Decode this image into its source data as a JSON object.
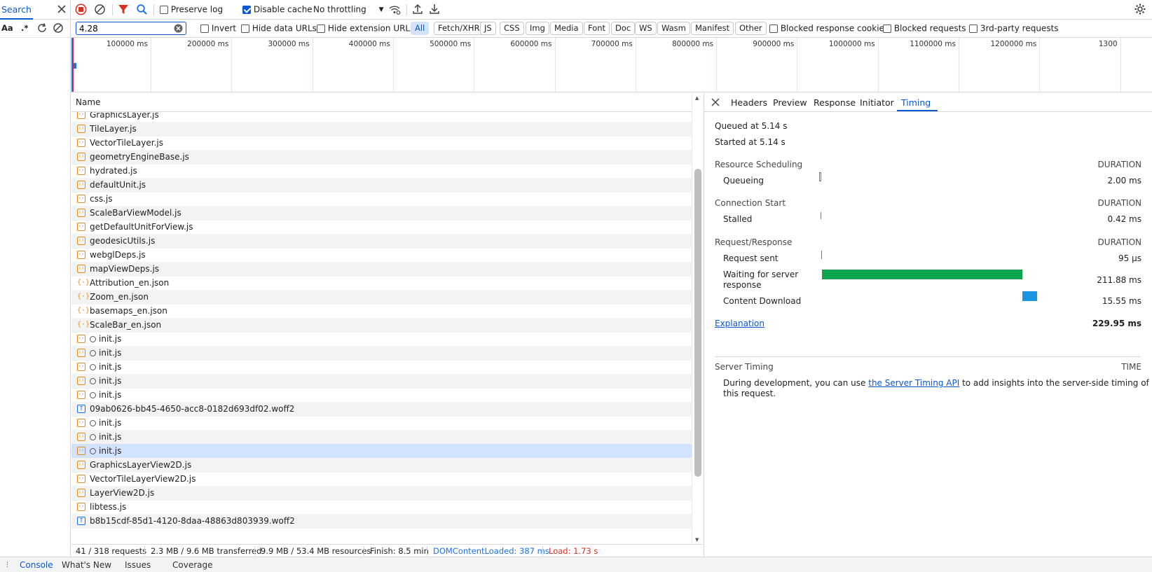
{
  "search_panel": {
    "tab_label": "Search",
    "case_toggle": "Aa",
    "regex_toggle": ".*"
  },
  "toolbar": {
    "preserve_log": "Preserve log",
    "disable_cache": "Disable cache",
    "throttling": "No throttling"
  },
  "filter": {
    "value": "4.28",
    "invert": "Invert",
    "hide_data_urls": "Hide data URLs",
    "hide_extension_urls": "Hide extension URLs",
    "types": [
      "All",
      "Fetch/XHR",
      "JS",
      "CSS",
      "Img",
      "Media",
      "Font",
      "Doc",
      "WS",
      "Wasm",
      "Manifest",
      "Other"
    ],
    "blocked_cookies": "Blocked response cookies",
    "blocked_requests": "Blocked requests",
    "third_party": "3rd-party requests"
  },
  "overview": {
    "ticks": [
      "100000 ms",
      "200000 ms",
      "300000 ms",
      "400000 ms",
      "500000 ms",
      "600000 ms",
      "700000 ms",
      "800000 ms",
      "900000 ms",
      "1000000 ms",
      "1100000 ms",
      "1200000 ms",
      "1300"
    ]
  },
  "table": {
    "column_name": "Name",
    "rows": [
      {
        "name": "GraphicsLayer.js",
        "type": "js"
      },
      {
        "name": "TileLayer.js",
        "type": "js"
      },
      {
        "name": "VectorTileLayer.js",
        "type": "js"
      },
      {
        "name": "geometryEngineBase.js",
        "type": "js"
      },
      {
        "name": "hydrated.js",
        "type": "js"
      },
      {
        "name": "defaultUnit.js",
        "type": "js"
      },
      {
        "name": "css.js",
        "type": "js"
      },
      {
        "name": "ScaleBarViewModel.js",
        "type": "js"
      },
      {
        "name": "getDefaultUnitForView.js",
        "type": "js"
      },
      {
        "name": "geodesicUtils.js",
        "type": "js"
      },
      {
        "name": "webglDeps.js",
        "type": "js"
      },
      {
        "name": "mapViewDeps.js",
        "type": "js"
      },
      {
        "name": "Attribution_en.json",
        "type": "json"
      },
      {
        "name": "Zoom_en.json",
        "type": "json"
      },
      {
        "name": "basemaps_en.json",
        "type": "json"
      },
      {
        "name": "ScaleBar_en.json",
        "type": "json"
      },
      {
        "name": "init.js",
        "type": "worker"
      },
      {
        "name": "init.js",
        "type": "worker"
      },
      {
        "name": "init.js",
        "type": "worker"
      },
      {
        "name": "init.js",
        "type": "worker"
      },
      {
        "name": "init.js",
        "type": "worker"
      },
      {
        "name": "09ab0626-bb45-4650-acc8-0182d693df02.woff2",
        "type": "font"
      },
      {
        "name": "init.js",
        "type": "worker"
      },
      {
        "name": "init.js",
        "type": "worker"
      },
      {
        "name": "init.js",
        "type": "worker",
        "selected": true
      },
      {
        "name": "GraphicsLayerView2D.js",
        "type": "js"
      },
      {
        "name": "VectorTileLayerView2D.js",
        "type": "js"
      },
      {
        "name": "LayerView2D.js",
        "type": "js"
      },
      {
        "name": "libtess.js",
        "type": "js"
      },
      {
        "name": "b8b15cdf-85d1-4120-8daa-48863d803939.woff2",
        "type": "font"
      }
    ]
  },
  "status": {
    "requests": "41 / 318 requests",
    "transferred": "2.3 MB / 9.6 MB transferred",
    "resources": "9.9 MB / 53.4 MB resources",
    "finish": "Finish: 8.5 min",
    "dom_content_loaded": "DOMContentLoaded: 387 ms",
    "load": "Load: 1.73 s"
  },
  "details": {
    "tabs": [
      "Headers",
      "Preview",
      "Response",
      "Initiator",
      "Timing"
    ],
    "active_tab": "Timing",
    "queued_at": "Queued at 5.14 s",
    "started_at": "Started at 5.14 s",
    "duration_header": "DURATION",
    "sections": {
      "scheduling": "Resource Scheduling",
      "connection": "Connection Start",
      "request": "Request/Response"
    },
    "phases": {
      "queueing": {
        "label": "Queueing",
        "value": "2.00 ms"
      },
      "stalled": {
        "label": "Stalled",
        "value": "0.42 ms"
      },
      "request_sent": {
        "label": "Request sent",
        "value": "95 µs"
      },
      "waiting": {
        "label_line1": "Waiting for server",
        "label_line2": "response",
        "value": "211.88 ms"
      },
      "download": {
        "label": "Content Download",
        "value": "15.55 ms"
      }
    },
    "explanation": "Explanation",
    "total": "229.95 ms",
    "server_timing": {
      "title": "Server Timing",
      "time_header": "TIME",
      "text_before": "During development, you can use ",
      "link": "the Server Timing API",
      "text_after": " to add insights into the server-side timing of",
      "text_line2": "this request."
    }
  },
  "drawer": {
    "tabs": [
      "Console",
      "What's New",
      "Issues",
      "Coverage"
    ]
  },
  "colors": {
    "accent": "#0b57d0",
    "waiting_bar": "#0ea44f",
    "download_bar": "#1a97e0",
    "load_text": "#d93025",
    "dcl_text": "#1a73e8",
    "record_red": "#d93025"
  }
}
